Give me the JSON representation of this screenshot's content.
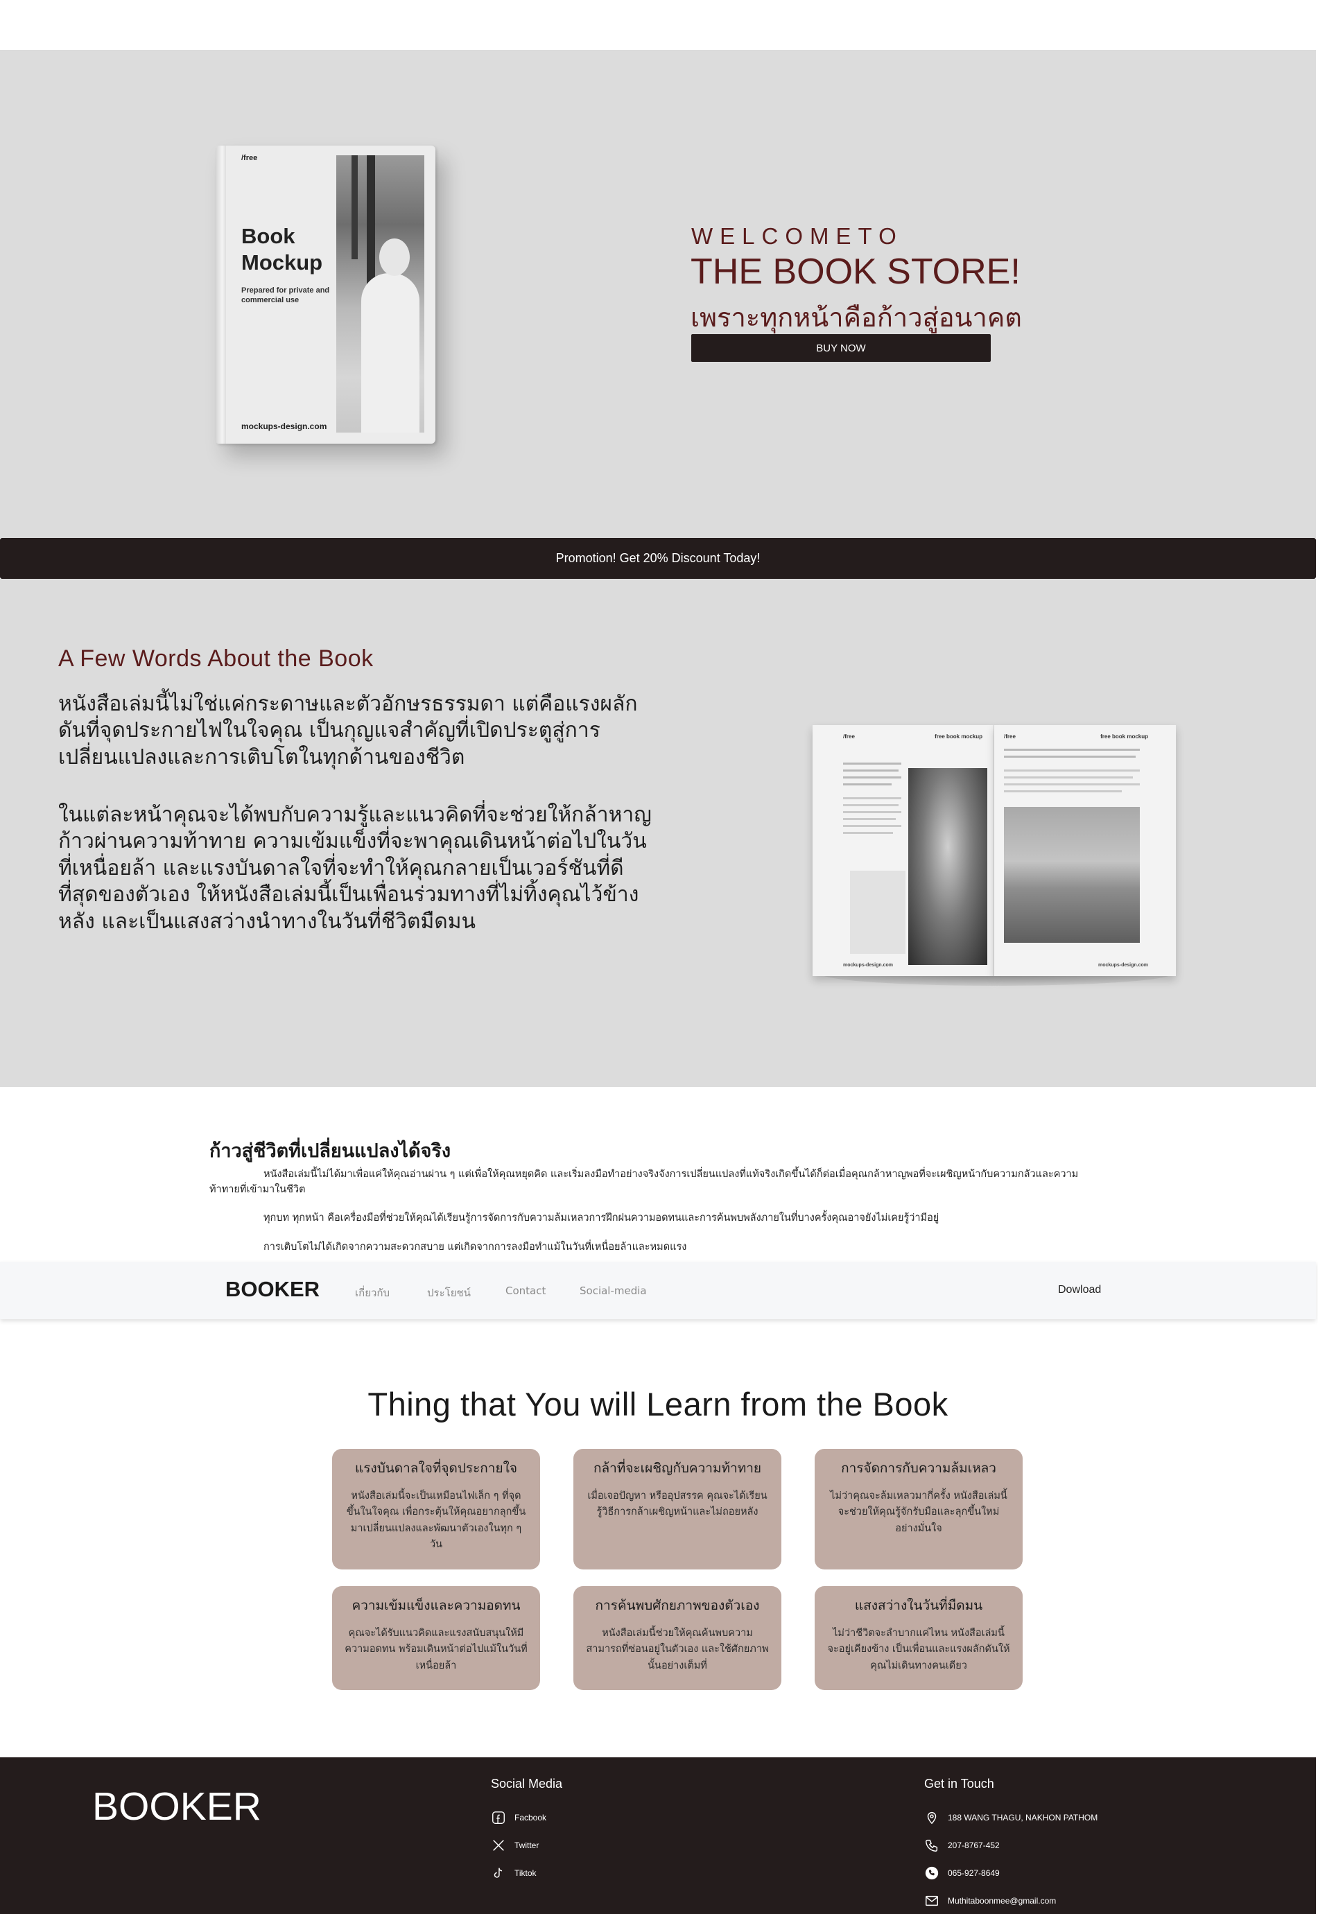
{
  "hero": {
    "book_cover": {
      "label": "/free",
      "title": "Book Mockup",
      "subtitle": "Prepared for private and commercial use",
      "site": "mockups-design.com"
    },
    "welcome": "WELCOMETO",
    "title": "THE BOOK STORE!",
    "tagline": "เพราะทุกหน้าคือก้าวสู่อนาคต",
    "buy_button": "BUY NOW"
  },
  "promo": "Promotion! Get 20% Discount Today!",
  "about": {
    "title": "A Few Words About the Book",
    "paragraph1": "หนังสือเล่มนี้ไม่ใช่แค่กระดาษและตัวอักษรธรรมดา แต่คือแรงผลักดันที่จุดประกายไฟในใจคุณ เป็นกุญแจสำคัญที่เปิดประตูสู่การเปลี่ยนแปลงและการเติบโตในทุกด้านของชีวิต",
    "paragraph2": "ในแต่ละหน้าคุณจะได้พบกับความรู้และแนวคิดที่จะช่วยให้กล้าหาญก้าวผ่านความท้าทาย ความเข้มแข็งที่จะพาคุณเดินหน้าต่อไปในวันที่เหนื่อยล้า และแรงบันดาลใจที่จะทำให้คุณกลายเป็นเวอร์ชันที่ดีที่สุดของตัวเอง ให้หนังสือเล่มนี้เป็นเพื่อนร่วมทางที่ไม่ทิ้งคุณไว้ข้างหลัง และเป็นแสงสว่างนำทางในวันที่ชีวิตมืดมน",
    "open_book": {
      "left_label": "/free",
      "left_header": "free book mockup",
      "right_label": "/free",
      "right_header": "free book mockup",
      "left_footer": "mockups-design.com",
      "right_footer": "mockups-design.com"
    }
  },
  "story": {
    "title": "ก้าวสู่ชีวิตที่เปลี่ยนแปลงได้จริง",
    "paragraph1": "หนังสือเล่มนี้ไม่ได้มาเพื่อแค่ให้คุณอ่านผ่าน ๆ แต่เพื่อให้คุณหยุดคิด และเริ่มลงมือทำอย่างจริงจังการเปลี่ยนแปลงที่แท้จริงเกิดขึ้นได้ก็ต่อเมื่อคุณกล้าหาญพอที่จะเผชิญหน้ากับความกลัวและความท้าทายที่เข้ามาในชีวิต",
    "paragraph2": "ทุกบท ทุกหน้า คือเครื่องมือที่ช่วยให้คุณได้เรียนรู้การจัดการกับความล้มเหลวการฝึกฝนความอดทนและการค้นพบพลังภายในที่บางครั้งคุณอาจยังไม่เคยรู้ว่ามีอยู่",
    "paragraph3": "การเติบโตไม่ได้เกิดจากความสะดวกสบาย แต่เกิดจากการลงมือทำแม้ในวันที่เหนื่อยล้าและหมดแรง"
  },
  "nav": {
    "brand": "BOOKER",
    "links": [
      "เกี่ยวกับ",
      "ประโยชน์",
      "Contact",
      "Social-media"
    ],
    "download": "Dowload"
  },
  "learn": {
    "title": "Thing that You will Learn from the Book",
    "cards": [
      {
        "title": "แรงบันดาลใจที่จุดประกายใจ",
        "text": "หนังสือเล่มนี้จะเป็นเหมือนไฟเล็ก ๆ ที่จุดขึ้นในใจคุณ เพื่อกระตุ้นให้คุณอยากลุกขึ้นมาเปลี่ยนแปลงและพัฒนาตัวเองในทุก ๆ วัน"
      },
      {
        "title": "กล้าที่จะเผชิญกับความท้าทาย",
        "text": "เมื่อเจอปัญหา หรืออุปสรรค คุณจะได้เรียนรู้วิธีการกล้าเผชิญหน้าและไม่ถอยหลัง"
      },
      {
        "title": "การจัดการกับความล้มเหลว",
        "text": "ไม่ว่าคุณจะล้มเหลวมากี่ครั้ง หนังสือเล่มนี้จะช่วยให้คุณรู้จักรับมือและลุกขึ้นใหม่อย่างมั่นใจ"
      },
      {
        "title": "ความเข้มแข็งและความอดทน",
        "text": "คุณจะได้รับแนวคิดและแรงสนับสนุนให้มีความอดทน พร้อมเดินหน้าต่อไปแม้ในวันที่เหนื่อยล้า"
      },
      {
        "title": "การค้นพบศักยภาพของตัวเอง",
        "text": "หนังสือเล่มนี้ช่วยให้คุณค้นพบความสามารถที่ซ่อนอยู่ในตัวเอง และใช้ศักยภาพนั้นอย่างเต็มที่"
      },
      {
        "title": "แสงสว่างในวันที่มืดมน",
        "text": "ไม่ว่าชีวิตจะลำบากแค่ไหน หนังสือเล่มนี้จะอยู่เคียงข้าง เป็นเพื่อนและแรงผลักดันให้คุณไม่เดินทางคนเดียว"
      }
    ]
  },
  "footer": {
    "brand": "BOOKER",
    "social_heading": "Social Media",
    "social": [
      {
        "icon": "facebook-icon",
        "label": "Facbook"
      },
      {
        "icon": "twitter-x-icon",
        "label": "Twitter"
      },
      {
        "icon": "tiktok-icon",
        "label": "Tiktok"
      }
    ],
    "contact_heading": "Get in Touch",
    "contact": [
      {
        "icon": "location-pin-icon",
        "label": "188 WANG THAGU, NAKHON PATHOM"
      },
      {
        "icon": "phone-icon",
        "label": "207-8767-452"
      },
      {
        "icon": "phone-filled-icon",
        "label": "065-927-8649"
      },
      {
        "icon": "mail-icon",
        "label": "Muthitaboonmee@gmail.com"
      }
    ]
  },
  "colors": {
    "accent": "#5a1c1c",
    "dark": "#241c1c",
    "hero_bg": "#dcdcdc",
    "card_bg": "#c0aba3"
  }
}
